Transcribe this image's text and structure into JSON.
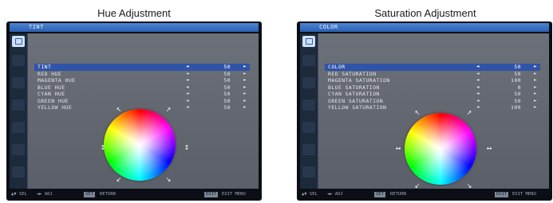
{
  "captions": {
    "left": "Hue Adjustment",
    "right": "Saturation Adjustment"
  },
  "screens": [
    {
      "title": "TINT",
      "rows": [
        {
          "label": "TINT",
          "value": "50",
          "selected": true
        },
        {
          "label": "RED HUE",
          "value": "50"
        },
        {
          "label": "MAGENTA HUE",
          "value": "50"
        },
        {
          "label": "BLUE HUE",
          "value": "50"
        },
        {
          "label": "CYAN HUE",
          "value": "50"
        },
        {
          "label": "GREEN HUE",
          "value": "50"
        },
        {
          "label": "YELLOW HUE",
          "value": "50"
        }
      ],
      "footer": {
        "sel": "▲▼ SEL",
        "adj": "◄► ADJ",
        "return_key": "SET",
        "return_label": "RETURN",
        "exit_key": "EXIT",
        "exit_label": "EXIT MENU"
      }
    },
    {
      "title": "COLOR",
      "rows": [
        {
          "label": "COLOR",
          "value": "50",
          "selected": true
        },
        {
          "label": "RED SATURATION",
          "value": "50"
        },
        {
          "label": "MAGENTA SATURATION",
          "value": "100"
        },
        {
          "label": "BLUE SATURATION",
          "value": "0"
        },
        {
          "label": "CYAN SATURATION",
          "value": "50"
        },
        {
          "label": "GREEN SATURATION",
          "value": "50"
        },
        {
          "label": "YELLOW SATURATION",
          "value": "100"
        }
      ],
      "footer": {
        "sel": "▲▼ SEL",
        "adj": "◄► ADJ",
        "return_key": "SET",
        "return_label": "RETURN",
        "exit_key": "EXIT",
        "exit_label": "EXIT MENU"
      }
    }
  ],
  "arrows": {
    "decrease": "◄",
    "increase": "►"
  },
  "colors": {
    "osd_title_bar": "#2c5fae",
    "selected_row": "#2f54a8",
    "panel_bg": "#6c7079"
  }
}
